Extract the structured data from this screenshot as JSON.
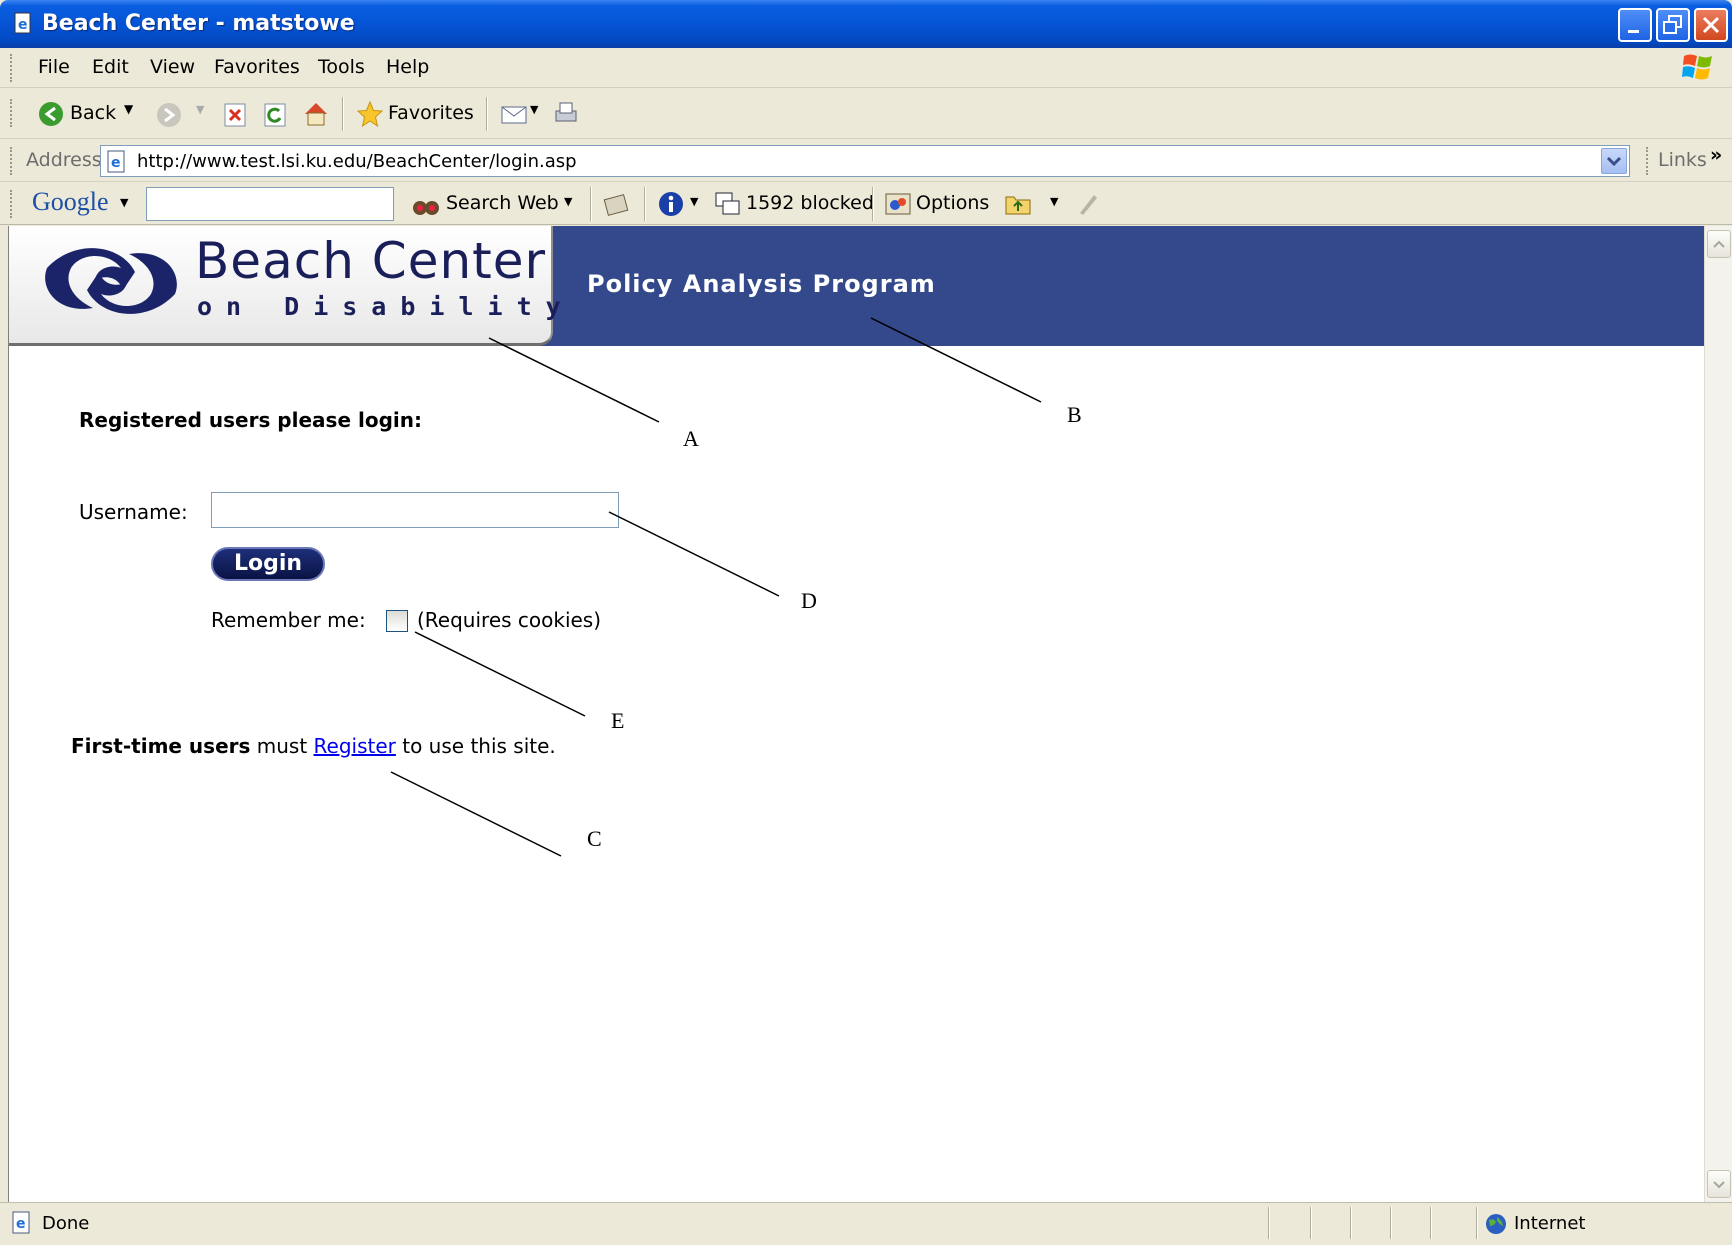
{
  "window": {
    "title": "Beach Center - matstowe"
  },
  "menu": [
    "File",
    "Edit",
    "View",
    "Favorites",
    "Tools",
    "Help"
  ],
  "toolbar": {
    "back_label": "Back",
    "favorites_label": "Favorites"
  },
  "address_bar": {
    "label": "Address",
    "url": "http://www.test.lsi.ku.edu/BeachCenter/login.asp",
    "links_label": "Links"
  },
  "google_toolbar": {
    "brand": "Google",
    "search_value": "",
    "search_web_label": "Search Web",
    "blocked_label": "1592 blocked",
    "options_label": "Options"
  },
  "banner": {
    "logo_title": "Beach Center",
    "logo_subtitle": "on Disability",
    "program_title": "Policy Analysis Program"
  },
  "page": {
    "login_heading": "Registered users please login:",
    "username_label": "Username:",
    "username_value": "",
    "login_button": "Login",
    "remember_label": "Remember me:",
    "remember_note": "(Requires cookies)",
    "first_time_bold": "First-time users",
    "first_time_mid": " must ",
    "register_link": "Register",
    "first_time_end": " to use this site."
  },
  "annotations": [
    "A",
    "B",
    "C",
    "D",
    "E"
  ],
  "status": {
    "left": "Done",
    "zone": "Internet"
  },
  "colors": {
    "banner": "#34498b",
    "titlebar": "#0654d6",
    "link": "#0000ee"
  }
}
